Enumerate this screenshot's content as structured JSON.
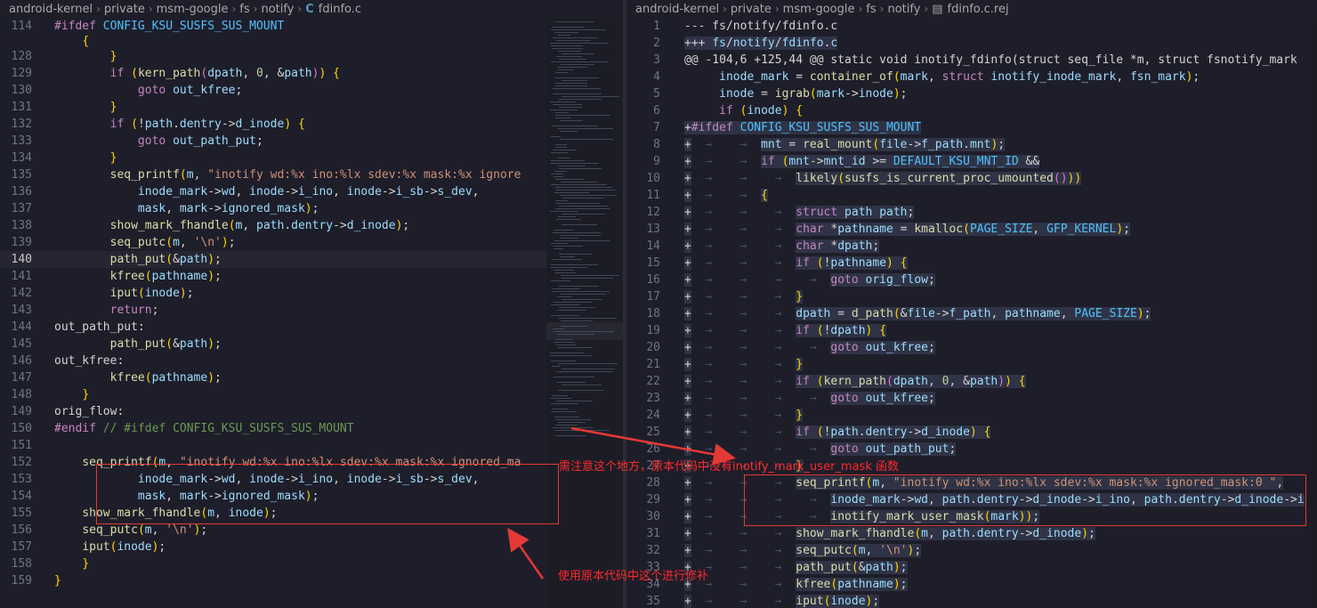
{
  "left_editor": {
    "breadcrumb": [
      "android-kernel",
      "private",
      "msm-google",
      "fs",
      "notify",
      "fdinfo.c"
    ],
    "lines": [
      {
        "n": "114",
        "t": "#ifdef CONFIG_KSU_SUSFS_SUS_MOUNT"
      },
      {
        "n": "",
        "t": "\t{"
      },
      {
        "n": "128",
        "t": "\t\t}"
      },
      {
        "n": "129",
        "t": "\t\tif (kern_path(dpath, 0, &path)) {"
      },
      {
        "n": "130",
        "t": "\t\t\tgoto out_kfree;"
      },
      {
        "n": "131",
        "t": "\t\t}"
      },
      {
        "n": "132",
        "t": "\t\tif (!path.dentry->d_inode) {"
      },
      {
        "n": "133",
        "t": "\t\t\tgoto out_path_put;"
      },
      {
        "n": "134",
        "t": "\t\t}"
      },
      {
        "n": "135",
        "t": "\t\tseq_printf(m, \"inotify wd:%x ino:%lx sdev:%x mask:%x ignore"
      },
      {
        "n": "136",
        "t": "\t\t\tinode_mark->wd, inode->i_ino, inode->i_sb->s_dev,"
      },
      {
        "n": "137",
        "t": "\t\t\tmask, mark->ignored_mask);"
      },
      {
        "n": "138",
        "t": "\t\tshow_mark_fhandle(m, path.dentry->d_inode);"
      },
      {
        "n": "139",
        "t": "\t\tseq_putc(m, '\\n');"
      },
      {
        "n": "140",
        "t": "\t\tpath_put(&path);"
      },
      {
        "n": "141",
        "t": "\t\tkfree(pathname);"
      },
      {
        "n": "142",
        "t": "\t\tiput(inode);"
      },
      {
        "n": "143",
        "t": "\t\treturn;"
      },
      {
        "n": "144",
        "t": "out_path_put:"
      },
      {
        "n": "145",
        "t": "\t\tpath_put(&path);"
      },
      {
        "n": "146",
        "t": "out_kfree:"
      },
      {
        "n": "147",
        "t": "\t\tkfree(pathname);"
      },
      {
        "n": "148",
        "t": "\t}"
      },
      {
        "n": "149",
        "t": "orig_flow:"
      },
      {
        "n": "150",
        "t": "#endif // #ifdef CONFIG_KSU_SUSFS_SUS_MOUNT"
      },
      {
        "n": "151",
        "t": ""
      },
      {
        "n": "152",
        "t": "\tseq_printf(m, \"inotify wd:%x ino:%lx sdev:%x mask:%x ignored_ma"
      },
      {
        "n": "153",
        "t": "\t\t\tinode_mark->wd, inode->i_ino, inode->i_sb->s_dev,"
      },
      {
        "n": "154",
        "t": "\t\t\tmask, mark->ignored_mask);"
      },
      {
        "n": "155",
        "t": "\tshow_mark_fhandle(m, inode);"
      },
      {
        "n": "156",
        "t": "\tseq_putc(m, '\\n');"
      },
      {
        "n": "157",
        "t": "\tiput(inode);"
      },
      {
        "n": "158",
        "t": "\t}"
      },
      {
        "n": "159",
        "t": "}"
      }
    ]
  },
  "right_editor": {
    "breadcrumb": [
      "android-kernel",
      "private",
      "msm-google",
      "fs",
      "notify",
      "fdinfo.c.rej"
    ],
    "lines": [
      {
        "n": "1",
        "t": "--- fs/notify/fdinfo.c"
      },
      {
        "n": "2",
        "t": "+++ fs/notify/fdinfo.c"
      },
      {
        "n": "3",
        "t": "@@ -104,6 +125,44 @@ static void inotify_fdinfo(struct seq_file *m, struct fsnotify_mark"
      },
      {
        "n": "4",
        "t": " \tinode_mark = container_of(mark, struct inotify_inode_mark, fsn_mark);"
      },
      {
        "n": "5",
        "t": " \tinode = igrab(mark->inode);"
      },
      {
        "n": "6",
        "t": " \tif (inode) {"
      },
      {
        "n": "7",
        "t": "+#ifdef CONFIG_KSU_SUSFS_SUS_MOUNT"
      },
      {
        "n": "8",
        "t": "+\t\tmnt = real_mount(file->f_path.mnt);"
      },
      {
        "n": "9",
        "t": "+\t\tif (mnt->mnt_id >= DEFAULT_KSU_MNT_ID &&"
      },
      {
        "n": "10",
        "t": "+\t\t\tlikely(susfs_is_current_proc_umounted()))"
      },
      {
        "n": "11",
        "t": "+\t\t{"
      },
      {
        "n": "12",
        "t": "+\t\t\tstruct path path;"
      },
      {
        "n": "13",
        "t": "+\t\t\tchar *pathname = kmalloc(PAGE_SIZE, GFP_KERNEL);"
      },
      {
        "n": "14",
        "t": "+\t\t\tchar *dpath;"
      },
      {
        "n": "15",
        "t": "+\t\t\tif (!pathname) {"
      },
      {
        "n": "16",
        "t": "+\t\t\t\tgoto orig_flow;"
      },
      {
        "n": "17",
        "t": "+\t\t\t}"
      },
      {
        "n": "18",
        "t": "+\t\t\tdpath = d_path(&file->f_path, pathname, PAGE_SIZE);"
      },
      {
        "n": "19",
        "t": "+\t\t\tif (!dpath) {"
      },
      {
        "n": "20",
        "t": "+\t\t\t\tgoto out_kfree;"
      },
      {
        "n": "21",
        "t": "+\t\t\t}"
      },
      {
        "n": "22",
        "t": "+\t\t\tif (kern_path(dpath, 0, &path)) {"
      },
      {
        "n": "23",
        "t": "+\t\t\t\tgoto out_kfree;"
      },
      {
        "n": "24",
        "t": "+\t\t\t}"
      },
      {
        "n": "25",
        "t": "+\t\t\tif (!path.dentry->d_inode) {"
      },
      {
        "n": "26",
        "t": "+\t\t\t\tgoto out_path_put;"
      },
      {
        "n": "27",
        "t": "+\t\t\t}"
      },
      {
        "n": "28",
        "t": "+\t\t\tseq_printf(m, \"inotify wd:%x ino:%lx sdev:%x mask:%x ignored_mask:0 \","
      },
      {
        "n": "29",
        "t": "+\t\t\t\tinode_mark->wd, path.dentry->d_inode->i_ino, path.dentry->d_inode->i_"
      },
      {
        "n": "30",
        "t": "+\t\t\t\tinotify_mark_user_mask(mark));"
      },
      {
        "n": "31",
        "t": "+\t\t\tshow_mark_fhandle(m, path.dentry->d_inode);"
      },
      {
        "n": "32",
        "t": "+\t\t\tseq_putc(m, '\\n');"
      },
      {
        "n": "33",
        "t": "+\t\t\tpath_put(&path);"
      },
      {
        "n": "34",
        "t": "+\t\t\tkfree(pathname);"
      },
      {
        "n": "35",
        "t": "+\t\t\tiput(inode);"
      }
    ]
  },
  "annotations": {
    "top_note": "需注意这个地方，原本代码中没有inotify_mark_user_mask 函数",
    "bottom_note": "使用原本代码中这个进行修补"
  },
  "colors": {
    "annotation": "#ff2a2a",
    "background": "#1e1e2a"
  }
}
